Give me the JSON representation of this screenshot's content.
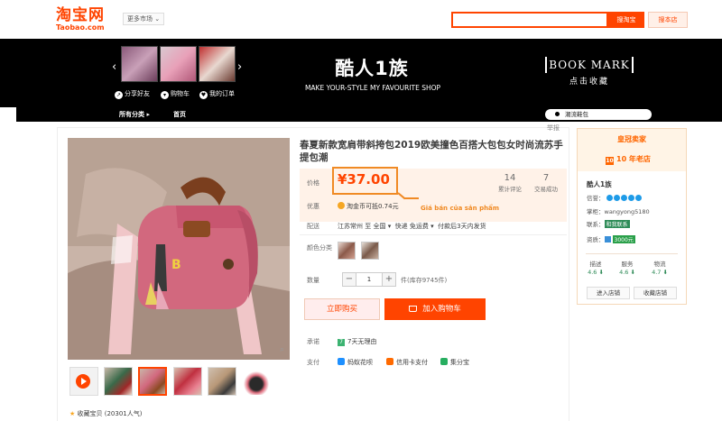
{
  "header": {
    "logo_cn": "淘宝网",
    "logo_en": "Taobao.com",
    "market_label": "更多市场",
    "search_button": "搜淘宝",
    "shop_search_button": "搜本店"
  },
  "banner": {
    "tools": [
      "分享好友",
      "购物车",
      "我的订单"
    ],
    "shop_title": "酷人1族",
    "slogan": "MAKE YOUR-STYLE MY FAVOURITE SHOP",
    "bookmark_en": "BOOK MARK",
    "bookmark_cn": "点击收藏"
  },
  "nav": {
    "all_categories": "所有分类",
    "home": "首页",
    "search_value": "潮流鞋包"
  },
  "product": {
    "title": "春夏新款宽肩带斜挎包2019欧美撞色百搭大包包女时尚流苏手提包潮",
    "report": "举报",
    "price_label": "价格",
    "price": "¥37.00",
    "reviews_count": "14",
    "reviews_label": "累计评论",
    "sales_count": "7",
    "sales_label": "交易成功",
    "promo_label": "优惠",
    "promo_text": "淘金币可抵0.74元",
    "annotation": "Giá bán của sản phẩm",
    "ship_label": "配送",
    "ship_from": "江苏常州 至",
    "ship_to": "全国",
    "ship_fee": "快递 免运费",
    "ship_time": "付款后3天内发货",
    "color_label": "颜色分类",
    "qty_label": "数量",
    "qty_minus": "−",
    "qty_value": "1",
    "qty_plus": "+",
    "stock_text": "件(库存9745件)",
    "buy_now": "立即购买",
    "add_cart": "加入购物车",
    "promise_label": "承诺",
    "promise_badge": "7",
    "promise_text": "7天无理由",
    "pay_label": "支付",
    "payments": [
      "蚂蚁花呗",
      "信用卡支付",
      "集分宝"
    ],
    "favorite_text": "收藏宝贝 (20301人气)",
    "zoom_icon": "search-icon",
    "accent_color": "#ff4400",
    "annotation_color": "#f08a24"
  },
  "seller": {
    "crown_label": "皇冠卖家",
    "old_shop_badge": "10",
    "old_shop": "10 年老店",
    "shop_name": "酷人1族",
    "credit_label": "信誉：",
    "owner_label": "掌柜：",
    "owner_name": "wangyong5180",
    "contact_label": "联系：",
    "contact_tag": "和我联系",
    "qual_label": "资质：",
    "qual_tag": "3000元",
    "scores": [
      {
        "label": "描述",
        "value": "4.6"
      },
      {
        "label": "服务",
        "value": "4.6"
      },
      {
        "label": "物流",
        "value": "4.7"
      }
    ],
    "enter_shop": "进入店铺",
    "fav_shop": "收藏店铺"
  }
}
